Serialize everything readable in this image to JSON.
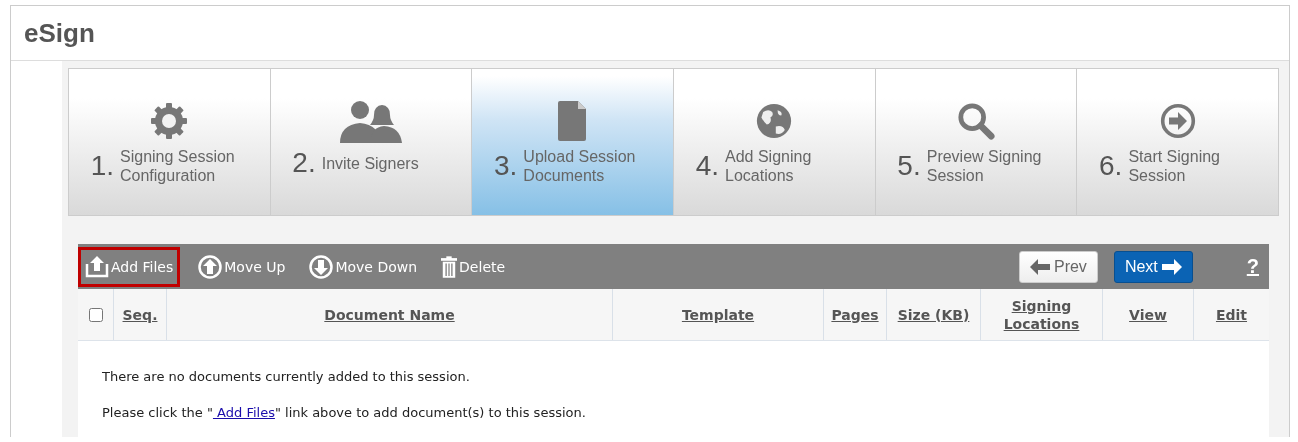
{
  "app": {
    "title": "eSign"
  },
  "steps": [
    {
      "number": "1.",
      "label": "Signing Session Configuration",
      "kind": "gear",
      "selected": false
    },
    {
      "number": "2.",
      "label": "Invite Signers",
      "kind": "people",
      "selected": false
    },
    {
      "number": "3.",
      "label": "Upload Session Documents",
      "kind": "document",
      "selected": true
    },
    {
      "number": "4.",
      "label": "Add Signing Locations",
      "kind": "globe",
      "selected": false
    },
    {
      "number": "5.",
      "label": "Preview Signing Session",
      "kind": "search",
      "selected": false
    },
    {
      "number": "6.",
      "label": "Start Signing Session",
      "kind": "arrow",
      "selected": false
    }
  ],
  "toolbar": {
    "actions": [
      {
        "label": "Add Files",
        "kind": "upload",
        "highlighted": true
      },
      {
        "label": "Move Up",
        "kind": "up",
        "highlighted": false
      },
      {
        "label": "Move Down",
        "kind": "down",
        "highlighted": false
      },
      {
        "label": "Delete",
        "kind": "trash",
        "highlighted": false
      }
    ],
    "prev": "Prev",
    "next": "Next",
    "help": "?"
  },
  "table": {
    "select_all": {
      "checked": false
    },
    "columns": [
      "Seq.",
      "Document Name",
      "Template",
      "Pages",
      "Size (KB)",
      "Signing Locations",
      "View",
      "Edit"
    ],
    "empty_message": "There are no documents currently added to this session.",
    "hint": {
      "before": "Please click the \"",
      "link": " Add Files",
      "after": "\" link above to add document(s) to this session."
    }
  }
}
